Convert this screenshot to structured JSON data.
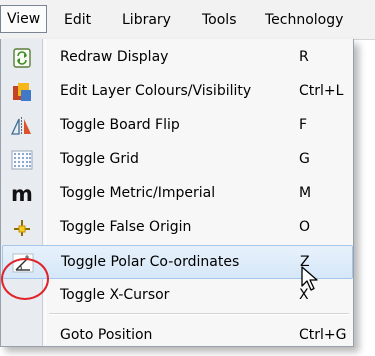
{
  "menubar": {
    "items": [
      {
        "label": "View",
        "active": true
      },
      {
        "label": "Edit",
        "active": false
      },
      {
        "label": "Library",
        "active": false
      },
      {
        "label": "Tools",
        "active": false
      },
      {
        "label": "Technology",
        "active": false
      }
    ]
  },
  "dropdown": {
    "items": [
      {
        "label": "Redraw Display",
        "shortcut": "R",
        "icon": "refresh-icon"
      },
      {
        "label": "Edit Layer Colours/Visibility",
        "shortcut": "Ctrl+L",
        "icon": "layers-icon"
      },
      {
        "label": "Toggle Board Flip",
        "shortcut": "F",
        "icon": "flip-icon"
      },
      {
        "label": "Toggle Grid",
        "shortcut": "G",
        "icon": "grid-icon"
      },
      {
        "label": "Toggle Metric/Imperial",
        "shortcut": "M",
        "icon": "metric-icon"
      },
      {
        "label": "Toggle False Origin",
        "shortcut": "O",
        "icon": "origin-icon"
      },
      {
        "label": "Toggle Polar Co-ordinates",
        "shortcut": "Z",
        "icon": "polar-coordinates-icon",
        "hover": true
      },
      {
        "label": "Toggle X-Cursor",
        "shortcut": "X",
        "icon": ""
      },
      {
        "label": "Goto Position",
        "shortcut": "Ctrl+G",
        "icon": ""
      }
    ]
  },
  "icons": {
    "metric_glyph": "m"
  },
  "colors": {
    "highlight": "#d6e7f8",
    "annotation_circle": "#e0242b"
  }
}
